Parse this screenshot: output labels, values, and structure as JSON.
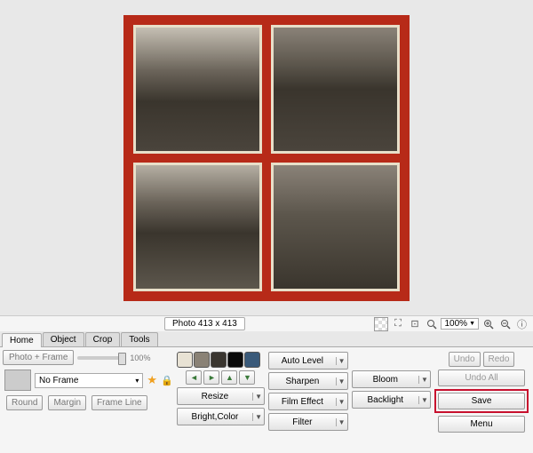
{
  "canvas": {
    "photo_size_label": "Photo 413 x 413",
    "zoom": "100%"
  },
  "tabs": [
    "Home",
    "Object",
    "Crop",
    "Tools"
  ],
  "home": {
    "photo_frame_btn": "Photo + Frame",
    "slider_pct": "100%",
    "frame_selected": "No Frame",
    "btn_round": "Round",
    "btn_margin": "Margin",
    "btn_frameline": "Frame Line"
  },
  "mid": {
    "resize": "Resize",
    "bright_color": "Bright,Color",
    "auto_level": "Auto Level",
    "sharpen": "Sharpen",
    "film_effect": "Film Effect",
    "filter": "Filter",
    "bloom": "Bloom",
    "backlight": "Backlight"
  },
  "right": {
    "undo": "Undo",
    "redo": "Redo",
    "undo_all": "Undo All",
    "save": "Save",
    "menu": "Menu"
  },
  "swatches": [
    "#e8e2d4",
    "#8a8276",
    "#3a3630",
    "#0a0a0a",
    "#3a5a7a"
  ]
}
